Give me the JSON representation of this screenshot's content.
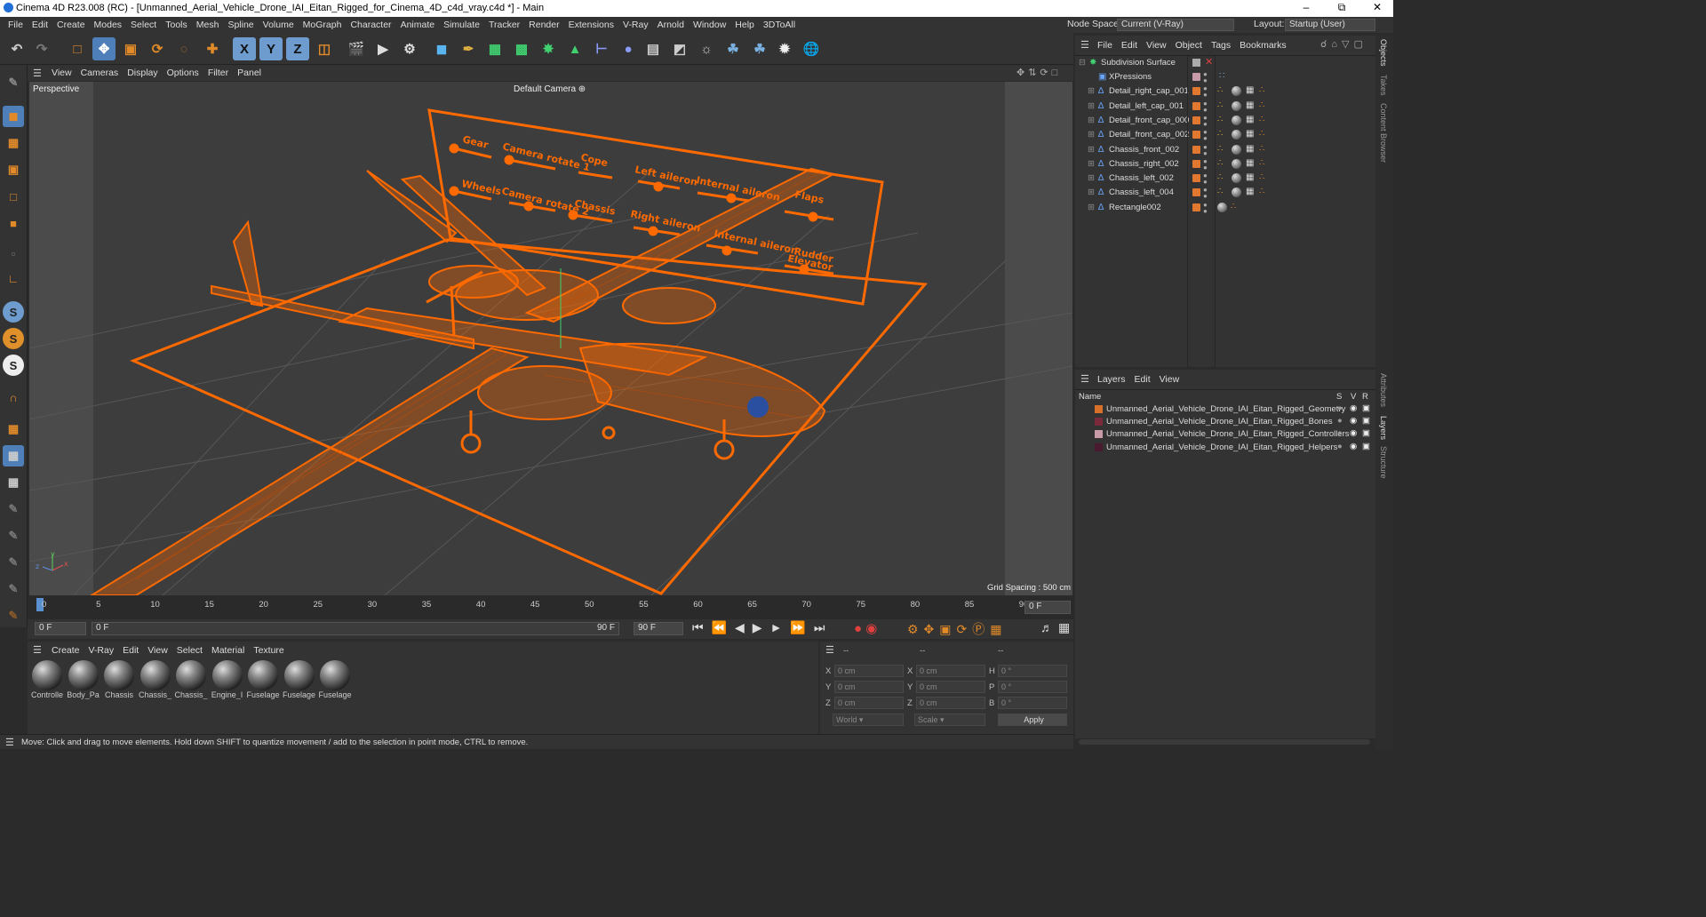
{
  "window": {
    "title": "Cinema 4D R23.008 (RC) - [Unmanned_Aerial_Vehicle_Drone_IAI_Eitan_Rigged_for_Cinema_4D_c4d_vray.c4d *] - Main"
  },
  "menubar": {
    "items": [
      "File",
      "Edit",
      "Create",
      "Modes",
      "Select",
      "Tools",
      "Mesh",
      "Spline",
      "Volume",
      "MoGraph",
      "Character",
      "Animate",
      "Simulate",
      "Tracker",
      "Render",
      "Extensions",
      "V-Ray",
      "Arnold",
      "Window",
      "Help",
      "3DToAll"
    ],
    "node_space_label": "Node Space:",
    "node_space_value": "Current (V-Ray)",
    "layout_label": "Layout:",
    "layout_value": "Startup (User)"
  },
  "toolbar": {
    "x_label": "X",
    "y_label": "Y",
    "z_label": "Z"
  },
  "viewport_menu": {
    "items": [
      "View",
      "Cameras",
      "Display",
      "Options",
      "Filter",
      "Panel"
    ]
  },
  "viewport": {
    "name": "Perspective",
    "camera": "Default Camera",
    "grid_spacing": "Grid Spacing : 500 cm",
    "panel_labels": [
      "Gear",
      "Camera rotate 1",
      "Cope",
      "Left aileron",
      "Internal aileron",
      "Flaps",
      "Wheels",
      "Camera rotate 2",
      "Chassis",
      "Right aileron",
      "Internal aileron",
      "Rudder",
      "Elevator"
    ],
    "accent": "#ff6a00"
  },
  "timeline": {
    "ticks": [
      "0",
      "5",
      "10",
      "15",
      "20",
      "25",
      "30",
      "35",
      "40",
      "45",
      "50",
      "55",
      "60",
      "65",
      "70",
      "75",
      "80",
      "85",
      "90"
    ],
    "current_frame": "0 F"
  },
  "transport": {
    "start": "0 F",
    "range_start": "0 F",
    "range_end": "90 F",
    "end": "90 F"
  },
  "material_menu": {
    "items": [
      "Create",
      "V-Ray",
      "Edit",
      "View",
      "Select",
      "Material",
      "Texture"
    ]
  },
  "materials": [
    "Controlle",
    "Body_Pa",
    "Chassis",
    "Chassis_",
    "Chassis_",
    "Engine_I",
    "Fuselage",
    "Fuselage",
    "Fuselage"
  ],
  "coords": {
    "header_a": "--",
    "header_b": "--",
    "header_c": "--",
    "x": "0 cm",
    "y": "0 cm",
    "z": "0 cm",
    "x2": "0 cm",
    "y2": "0 cm",
    "z2": "0 cm",
    "h": "0 °",
    "p": "0 °",
    "b": "0 °",
    "labels": {
      "x": "X",
      "y": "Y",
      "z": "Z",
      "h": "H",
      "p": "P",
      "b": "B"
    },
    "mode": "World",
    "scale": "Scale",
    "apply": "Apply"
  },
  "status": {
    "text": "Move: Click and drag to move elements. Hold down SHIFT to quantize movement / add to the selection in point mode, CTRL to remove."
  },
  "object_manager": {
    "menu": [
      "File",
      "Edit",
      "View",
      "Object",
      "Tags",
      "Bookmarks"
    ],
    "root": "Subdivision Surface",
    "objects": [
      "XPressions",
      "Detail_right_cap_001",
      "Detail_left_cap_001",
      "Detail_front_cap_000",
      "Detail_front_cap_002",
      "Chassis_front_002",
      "Chassis_right_002",
      "Chassis_left_002",
      "Chassis_left_004",
      "Rectangle002"
    ]
  },
  "layer_manager": {
    "menu": [
      "Layers",
      "Edit",
      "View"
    ],
    "name_header": "Name",
    "col_s": "S",
    "col_v": "V",
    "col_r": "R",
    "layers": [
      {
        "name": "Unmanned_Aerial_Vehicle_Drone_IAI_Eitan_Rigged_Geometry",
        "color": "#d8702a"
      },
      {
        "name": "Unmanned_Aerial_Vehicle_Drone_IAI_Eitan_Rigged_Bones",
        "color": "#7a2a3a"
      },
      {
        "name": "Unmanned_Aerial_Vehicle_Drone_IAI_Eitan_Rigged_Controllers",
        "color": "#c99aa8"
      },
      {
        "name": "Unmanned_Aerial_Vehicle_Drone_IAI_Eitan_Rigged_Helpers",
        "color": "#4a1a30"
      }
    ]
  },
  "right_tabs": [
    "Objects",
    "Takes",
    "Content Browser",
    "Attributes",
    "Layers",
    "Structure"
  ]
}
